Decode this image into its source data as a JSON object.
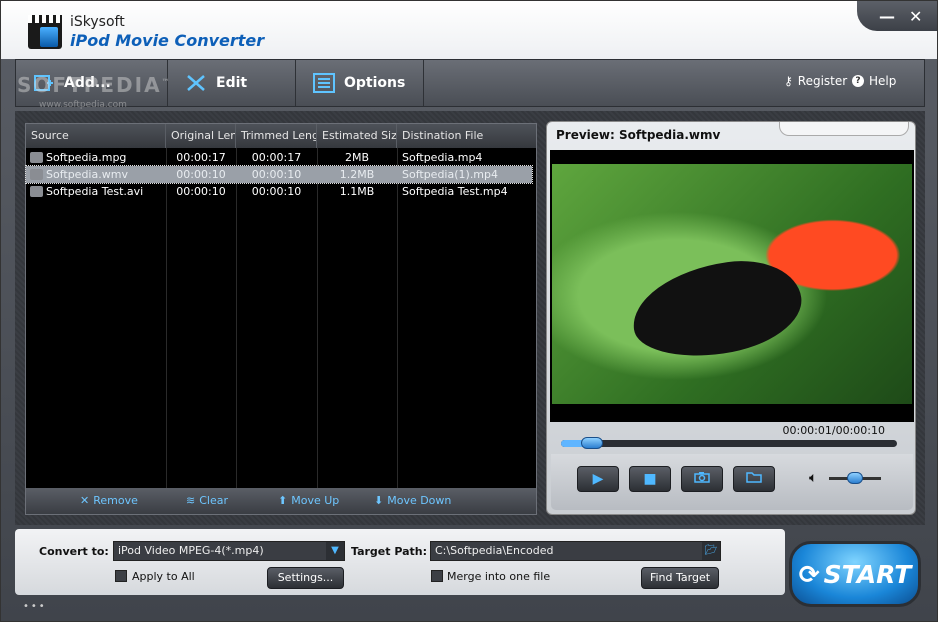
{
  "app": {
    "brand": "iSkysoft",
    "product": "iPod Movie Converter"
  },
  "window_buttons": {
    "minimize": "—",
    "close": "✕"
  },
  "watermark": {
    "name": "SOFTPEDIA",
    "tm": "™",
    "url": "www.softpedia.com"
  },
  "toolbar": {
    "add": "Add...",
    "edit": "Edit",
    "options": "Options",
    "register": "Register",
    "help": "Help"
  },
  "list": {
    "columns": [
      "Source",
      "Original Len...",
      "Trimmed Length",
      "Estimated Size",
      "Distination File"
    ],
    "rows": [
      {
        "source": "Softpedia.mpg",
        "original": "00:00:17",
        "trimmed": "00:00:17",
        "size": "2MB",
        "dest": "Softpedia.mp4",
        "selected": false
      },
      {
        "source": "Softpedia.wmv",
        "original": "00:00:10",
        "trimmed": "00:00:10",
        "size": "1.2MB",
        "dest": "Softpedia(1).mp4",
        "selected": true
      },
      {
        "source": "Softpedia Test.avi",
        "original": "00:00:10",
        "trimmed": "00:00:10",
        "size": "1.1MB",
        "dest": "Softpedia Test.mp4",
        "selected": false
      }
    ],
    "footer": {
      "remove": "Remove",
      "clear": "Clear",
      "move_up": "Move Up",
      "move_down": "Move Down"
    }
  },
  "preview": {
    "title": "Preview: Softpedia.wmv",
    "time": "00:00:01/00:00:10",
    "seek_fraction": 0.1
  },
  "controls": {
    "play": "play-icon",
    "stop": "stop-icon",
    "snapshot": "camera-icon",
    "open_folder": "folder-icon",
    "volume": "speaker-icon"
  },
  "bottom": {
    "convert_to_label": "Convert to:",
    "convert_to_value": "iPod Video MPEG-4(*.mp4)",
    "target_path_label": "Target Path:",
    "target_path_value": "C:\\Softpedia\\Encoded",
    "apply_to_all": "Apply to All",
    "settings": "Settings...",
    "merge": "Merge into one file",
    "find_target": "Find Target"
  },
  "start": "START",
  "colors": {
    "accent": "#4fb8ff",
    "title_blue": "#0d5fb8"
  }
}
